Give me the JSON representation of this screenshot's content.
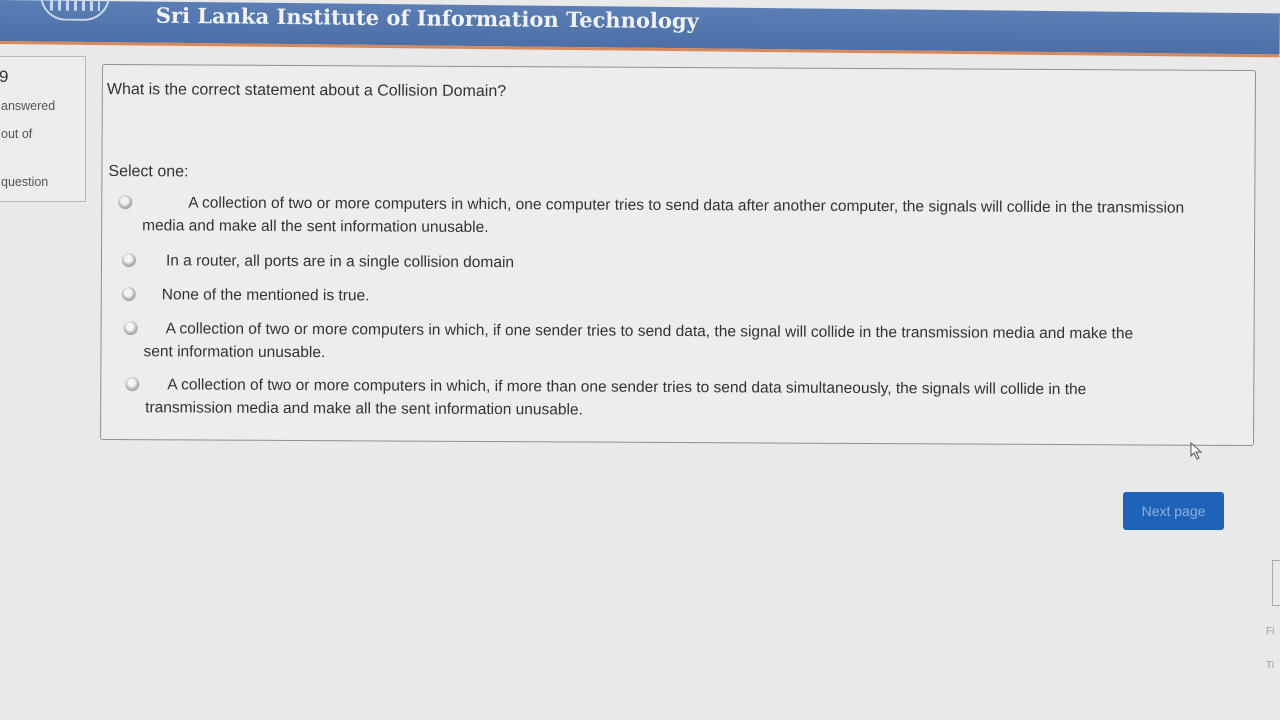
{
  "header": {
    "title": "Sri Lanka Institute of Information Technology"
  },
  "info": {
    "number": "9",
    "status": "answered",
    "marks": "out of",
    "flag": "question"
  },
  "question": {
    "text": "What is the correct statement about a Collision Domain?",
    "select_label": "Select one:",
    "answers": [
      "A collection of two or more computers in which, one computer tries to send data after another computer, the signals will collide in the transmission media and make all the sent information unusable.",
      "In a router, all ports are in a single collision domain",
      "None of the mentioned is true.",
      "A collection of two or more computers in which, if one sender tries to send data, the signal will collide in the transmission media and make the sent information unusable.",
      "A collection of two or more computers in which, if more than one sender tries to send data simultaneously, the signals will collide in the transmission media and make all the sent information unusable."
    ]
  },
  "nav": {
    "next_label": "Next page"
  },
  "edge": {
    "mark1": "Fi",
    "mark2": "Ti"
  },
  "colors": {
    "header": "#4b6fa6",
    "header_border": "#d9885a",
    "button": "#1f63b8"
  }
}
